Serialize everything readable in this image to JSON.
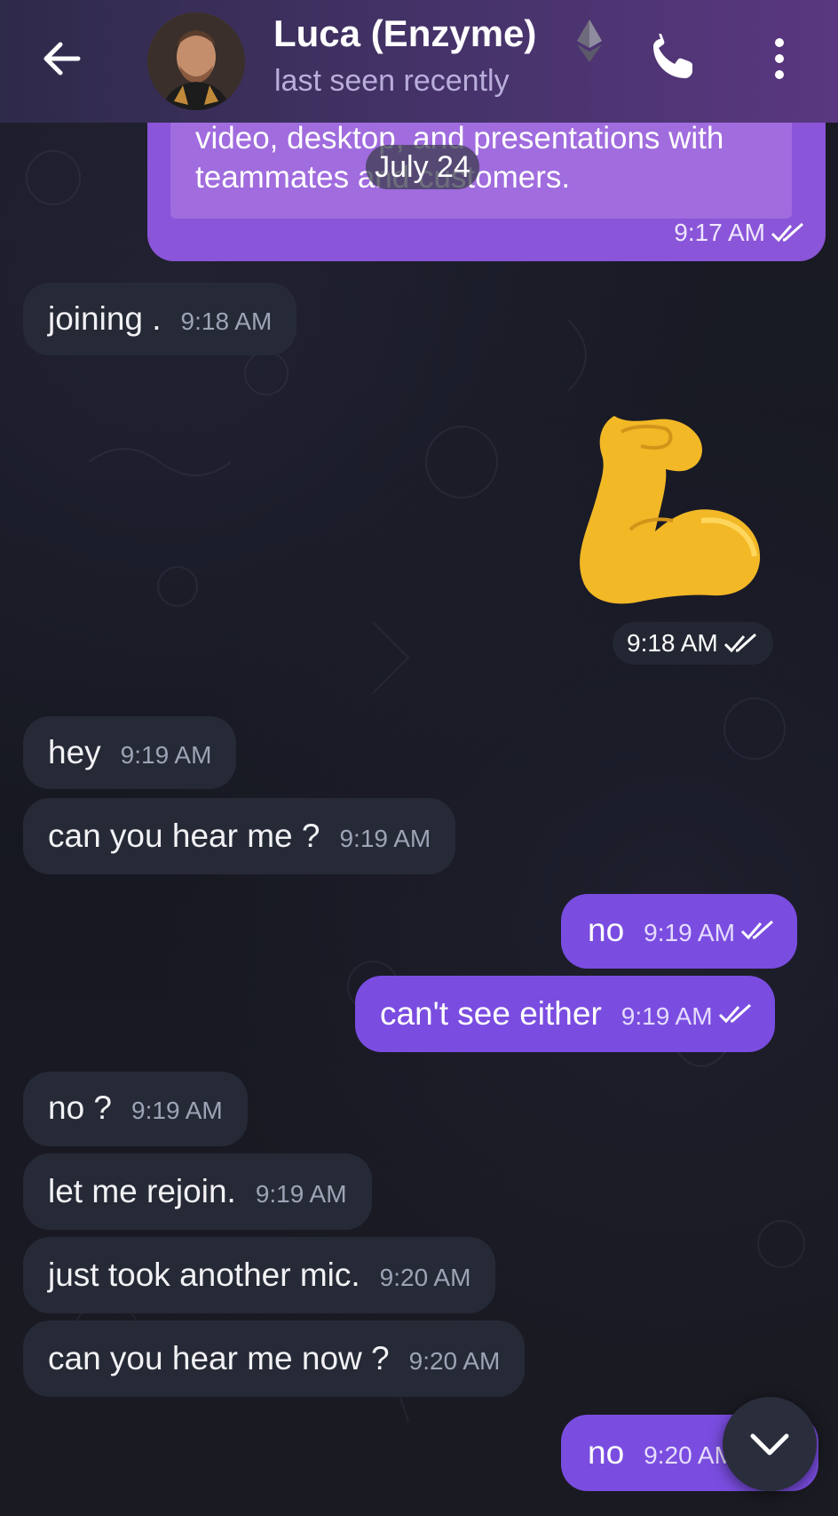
{
  "header": {
    "contact_name": "Luca (Enzyme)",
    "status": "last seen recently"
  },
  "date_separator": "July 24",
  "quoted_message": {
    "line1": "video, desktop, and presentations with",
    "line2": "teammates and customers.",
    "time": "9:17 AM"
  },
  "messages": [
    {
      "side": "in",
      "text": "joining .",
      "time": "9:18 AM"
    },
    {
      "side": "out",
      "sticker": "flexed-biceps",
      "time": "9:18 AM"
    },
    {
      "side": "in",
      "text": "hey",
      "time": "9:19 AM"
    },
    {
      "side": "in",
      "text": "can you hear me ?",
      "time": "9:19 AM"
    },
    {
      "side": "out",
      "text": "no",
      "time": "9:19 AM"
    },
    {
      "side": "out",
      "text": "can't see either",
      "time": "9:19 AM"
    },
    {
      "side": "in",
      "text": "no ?",
      "time": "9:19 AM"
    },
    {
      "side": "in",
      "text": "let me rejoin.",
      "time": "9:19 AM"
    },
    {
      "side": "in",
      "text": "just took another mic.",
      "time": "9:20 AM"
    },
    {
      "side": "in",
      "text": "can you hear me now ?",
      "time": "9:20 AM"
    },
    {
      "side": "out",
      "text": "no",
      "time": "9:20 AM"
    }
  ],
  "colors": {
    "header_start": "#2e2a4a",
    "header_end": "#5a3780",
    "outgoing_bubble": "#7a4de0",
    "incoming_bubble": "#262a37"
  }
}
